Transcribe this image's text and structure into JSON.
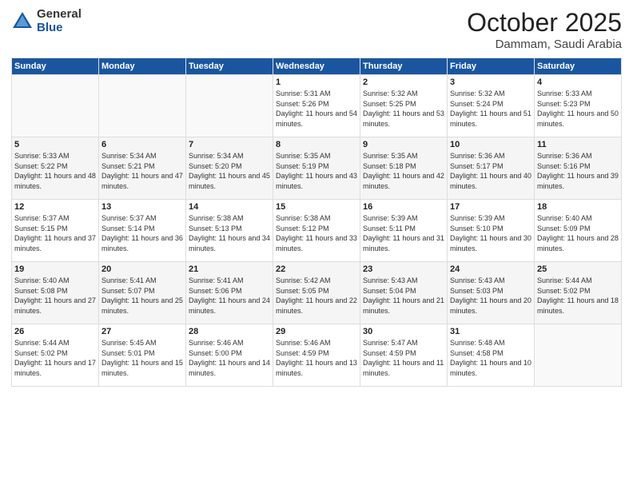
{
  "logo": {
    "general": "General",
    "blue": "Blue"
  },
  "header": {
    "month": "October 2025",
    "location": "Dammam, Saudi Arabia"
  },
  "weekdays": [
    "Sunday",
    "Monday",
    "Tuesday",
    "Wednesday",
    "Thursday",
    "Friday",
    "Saturday"
  ],
  "weeks": [
    [
      {
        "day": "",
        "sunrise": "",
        "sunset": "",
        "daylight": ""
      },
      {
        "day": "",
        "sunrise": "",
        "sunset": "",
        "daylight": ""
      },
      {
        "day": "",
        "sunrise": "",
        "sunset": "",
        "daylight": ""
      },
      {
        "day": "1",
        "sunrise": "Sunrise: 5:31 AM",
        "sunset": "Sunset: 5:26 PM",
        "daylight": "Daylight: 11 hours and 54 minutes."
      },
      {
        "day": "2",
        "sunrise": "Sunrise: 5:32 AM",
        "sunset": "Sunset: 5:25 PM",
        "daylight": "Daylight: 11 hours and 53 minutes."
      },
      {
        "day": "3",
        "sunrise": "Sunrise: 5:32 AM",
        "sunset": "Sunset: 5:24 PM",
        "daylight": "Daylight: 11 hours and 51 minutes."
      },
      {
        "day": "4",
        "sunrise": "Sunrise: 5:33 AM",
        "sunset": "Sunset: 5:23 PM",
        "daylight": "Daylight: 11 hours and 50 minutes."
      }
    ],
    [
      {
        "day": "5",
        "sunrise": "Sunrise: 5:33 AM",
        "sunset": "Sunset: 5:22 PM",
        "daylight": "Daylight: 11 hours and 48 minutes."
      },
      {
        "day": "6",
        "sunrise": "Sunrise: 5:34 AM",
        "sunset": "Sunset: 5:21 PM",
        "daylight": "Daylight: 11 hours and 47 minutes."
      },
      {
        "day": "7",
        "sunrise": "Sunrise: 5:34 AM",
        "sunset": "Sunset: 5:20 PM",
        "daylight": "Daylight: 11 hours and 45 minutes."
      },
      {
        "day": "8",
        "sunrise": "Sunrise: 5:35 AM",
        "sunset": "Sunset: 5:19 PM",
        "daylight": "Daylight: 11 hours and 43 minutes."
      },
      {
        "day": "9",
        "sunrise": "Sunrise: 5:35 AM",
        "sunset": "Sunset: 5:18 PM",
        "daylight": "Daylight: 11 hours and 42 minutes."
      },
      {
        "day": "10",
        "sunrise": "Sunrise: 5:36 AM",
        "sunset": "Sunset: 5:17 PM",
        "daylight": "Daylight: 11 hours and 40 minutes."
      },
      {
        "day": "11",
        "sunrise": "Sunrise: 5:36 AM",
        "sunset": "Sunset: 5:16 PM",
        "daylight": "Daylight: 11 hours and 39 minutes."
      }
    ],
    [
      {
        "day": "12",
        "sunrise": "Sunrise: 5:37 AM",
        "sunset": "Sunset: 5:15 PM",
        "daylight": "Daylight: 11 hours and 37 minutes."
      },
      {
        "day": "13",
        "sunrise": "Sunrise: 5:37 AM",
        "sunset": "Sunset: 5:14 PM",
        "daylight": "Daylight: 11 hours and 36 minutes."
      },
      {
        "day": "14",
        "sunrise": "Sunrise: 5:38 AM",
        "sunset": "Sunset: 5:13 PM",
        "daylight": "Daylight: 11 hours and 34 minutes."
      },
      {
        "day": "15",
        "sunrise": "Sunrise: 5:38 AM",
        "sunset": "Sunset: 5:12 PM",
        "daylight": "Daylight: 11 hours and 33 minutes."
      },
      {
        "day": "16",
        "sunrise": "Sunrise: 5:39 AM",
        "sunset": "Sunset: 5:11 PM",
        "daylight": "Daylight: 11 hours and 31 minutes."
      },
      {
        "day": "17",
        "sunrise": "Sunrise: 5:39 AM",
        "sunset": "Sunset: 5:10 PM",
        "daylight": "Daylight: 11 hours and 30 minutes."
      },
      {
        "day": "18",
        "sunrise": "Sunrise: 5:40 AM",
        "sunset": "Sunset: 5:09 PM",
        "daylight": "Daylight: 11 hours and 28 minutes."
      }
    ],
    [
      {
        "day": "19",
        "sunrise": "Sunrise: 5:40 AM",
        "sunset": "Sunset: 5:08 PM",
        "daylight": "Daylight: 11 hours and 27 minutes."
      },
      {
        "day": "20",
        "sunrise": "Sunrise: 5:41 AM",
        "sunset": "Sunset: 5:07 PM",
        "daylight": "Daylight: 11 hours and 25 minutes."
      },
      {
        "day": "21",
        "sunrise": "Sunrise: 5:41 AM",
        "sunset": "Sunset: 5:06 PM",
        "daylight": "Daylight: 11 hours and 24 minutes."
      },
      {
        "day": "22",
        "sunrise": "Sunrise: 5:42 AM",
        "sunset": "Sunset: 5:05 PM",
        "daylight": "Daylight: 11 hours and 22 minutes."
      },
      {
        "day": "23",
        "sunrise": "Sunrise: 5:43 AM",
        "sunset": "Sunset: 5:04 PM",
        "daylight": "Daylight: 11 hours and 21 minutes."
      },
      {
        "day": "24",
        "sunrise": "Sunrise: 5:43 AM",
        "sunset": "Sunset: 5:03 PM",
        "daylight": "Daylight: 11 hours and 20 minutes."
      },
      {
        "day": "25",
        "sunrise": "Sunrise: 5:44 AM",
        "sunset": "Sunset: 5:02 PM",
        "daylight": "Daylight: 11 hours and 18 minutes."
      }
    ],
    [
      {
        "day": "26",
        "sunrise": "Sunrise: 5:44 AM",
        "sunset": "Sunset: 5:02 PM",
        "daylight": "Daylight: 11 hours and 17 minutes."
      },
      {
        "day": "27",
        "sunrise": "Sunrise: 5:45 AM",
        "sunset": "Sunset: 5:01 PM",
        "daylight": "Daylight: 11 hours and 15 minutes."
      },
      {
        "day": "28",
        "sunrise": "Sunrise: 5:46 AM",
        "sunset": "Sunset: 5:00 PM",
        "daylight": "Daylight: 11 hours and 14 minutes."
      },
      {
        "day": "29",
        "sunrise": "Sunrise: 5:46 AM",
        "sunset": "Sunset: 4:59 PM",
        "daylight": "Daylight: 11 hours and 13 minutes."
      },
      {
        "day": "30",
        "sunrise": "Sunrise: 5:47 AM",
        "sunset": "Sunset: 4:59 PM",
        "daylight": "Daylight: 11 hours and 11 minutes."
      },
      {
        "day": "31",
        "sunrise": "Sunrise: 5:48 AM",
        "sunset": "Sunset: 4:58 PM",
        "daylight": "Daylight: 11 hours and 10 minutes."
      },
      {
        "day": "",
        "sunrise": "",
        "sunset": "",
        "daylight": ""
      }
    ]
  ]
}
